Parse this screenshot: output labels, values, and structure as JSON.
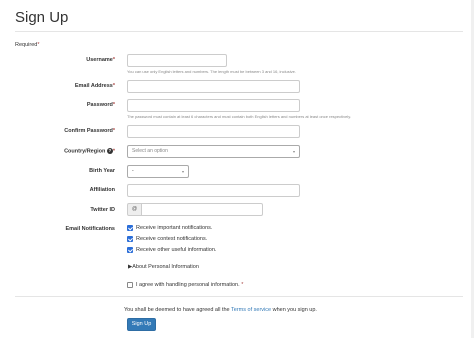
{
  "page": {
    "title": "Sign Up",
    "required_note": "Required"
  },
  "form": {
    "username": {
      "label": "Username",
      "value": "",
      "help": "You can use only English letters and numbers. The length must be between 3 and 16, inclusive."
    },
    "email": {
      "label": "Email Address",
      "value": ""
    },
    "password": {
      "label": "Password",
      "value": "",
      "help": "The password must contain at least 6 characters and must contain both English letters and numbers at least once respectively."
    },
    "confirm_password": {
      "label": "Confirm Password",
      "value": ""
    },
    "country": {
      "label": "Country/Region",
      "placeholder": "Select an option",
      "help_icon": "question-circle-icon"
    },
    "birth_year": {
      "label": "Birth Year",
      "selected": "-"
    },
    "affiliation": {
      "label": "Affiliation",
      "value": ""
    },
    "twitter": {
      "label": "Twitter ID",
      "addon": "@",
      "value": ""
    },
    "email_notifications": {
      "label": "Email Notifications",
      "options": [
        {
          "label": "Receive important notifications.",
          "checked": true
        },
        {
          "label": "Receive contest notifications.",
          "checked": true
        },
        {
          "label": "Receive other useful information.",
          "checked": true
        }
      ]
    },
    "about_personal": "▶About Personal Information",
    "agree_personal": {
      "label": "I agree with handling personal information. ",
      "checked": false
    },
    "terms": {
      "prefix": "You shall be deemed to have agreed all the ",
      "link": "Terms of service",
      "suffix": " when you sign up."
    },
    "submit_label": "Sign Up"
  },
  "colors": {
    "accent": "#337ab7",
    "required": "#a94442",
    "checkbox": "#2a6dd8"
  }
}
